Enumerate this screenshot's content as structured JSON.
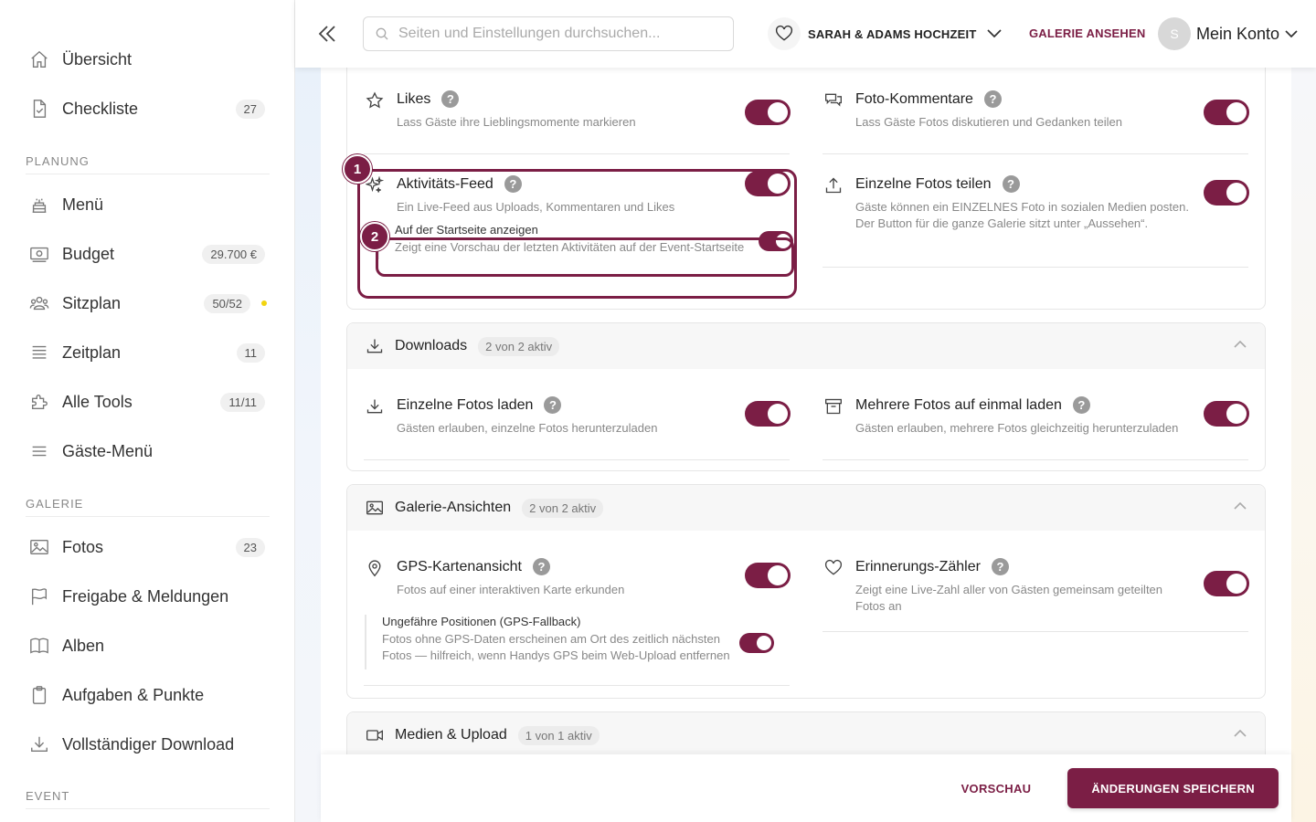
{
  "sidebar": {
    "items": [
      {
        "label": "Übersicht",
        "icon": "home-icon"
      },
      {
        "label": "Checkliste",
        "badge": "27",
        "icon": "checklist-icon"
      },
      {
        "label": "Menü",
        "icon": "cake-icon"
      },
      {
        "label": "Budget",
        "badge": "29.700 €",
        "icon": "money-icon"
      },
      {
        "label": "Sitzplan",
        "badge": "50/52",
        "icon": "people-icon"
      },
      {
        "label": "Zeitplan",
        "badge": "11",
        "icon": "timeline-icon"
      },
      {
        "label": "Alle Tools",
        "badge": "11/11",
        "icon": "puzzle-icon"
      },
      {
        "label": "Gäste-Menü",
        "icon": "menu-icon"
      },
      {
        "label": "Fotos",
        "badge": "23",
        "icon": "image-icon"
      },
      {
        "label": "Freigabe & Meldungen",
        "icon": "flag-icon"
      },
      {
        "label": "Alben",
        "icon": "book-icon"
      },
      {
        "label": "Aufgaben & Punkte",
        "icon": "clipboard-icon"
      },
      {
        "label": "Vollständiger Download",
        "icon": "download-icon"
      }
    ],
    "sections": {
      "planung": "PLANUNG",
      "galerie": "GALERIE",
      "event": "EVENT"
    }
  },
  "header": {
    "search_placeholder": "Seiten und Einstellungen durchsuchen...",
    "event_name": "SARAH & ADAMS HOCHZEIT",
    "gallery_link": "GALERIE ANSEHEN",
    "avatar_initial": "S",
    "account_label": "Mein Konto"
  },
  "interactions": {
    "likes": {
      "title": "Likes",
      "desc": "Lass Gäste ihre Lieblingsmomente markieren"
    },
    "comments": {
      "title": "Foto-Kommentare",
      "desc": "Lass Gäste Fotos diskutieren und Gedanken teilen"
    },
    "activity": {
      "title": "Aktivitäts-Feed",
      "desc": "Ein Live-Feed aus Uploads, Kommentaren und Likes"
    },
    "activity_sub": {
      "title": "Auf der Startseite anzeigen",
      "desc": "Zeigt eine Vorschau der letzten Aktivitäten auf der Event-Startseite"
    },
    "share": {
      "title": "Einzelne Fotos teilen",
      "desc": "Gäste können ein EINZELNES Foto in sozialen Medien posten. Der Button für die ganze Galerie sitzt unter „Aussehen“."
    }
  },
  "downloads": {
    "title": "Downloads",
    "count": "2 von 2 aktiv",
    "single": {
      "title": "Einzelne Fotos laden",
      "desc": "Gästen erlauben, einzelne Fotos herunterzuladen"
    },
    "multi": {
      "title": "Mehrere Fotos auf einmal laden",
      "desc": "Gästen erlauben, mehrere Fotos gleichzeitig herunterzuladen"
    }
  },
  "views": {
    "title": "Galerie-Ansichten",
    "count": "2 von 2 aktiv",
    "gps": {
      "title": "GPS-Kartenansicht",
      "desc": "Fotos auf einer interaktiven Karte erkunden"
    },
    "gps_sub": {
      "title": "Ungefähre Positionen (GPS-Fallback)",
      "desc": "Fotos ohne GPS-Daten erscheinen am Ort des zeitlich nächsten Fotos — hilfreich, wenn Handys GPS beim Web-Upload entfernen"
    },
    "memory": {
      "title": "Erinnerungs-Zähler",
      "desc": "Zeigt eine Live-Zahl aller von Gästen gemeinsam geteilten Fotos an"
    }
  },
  "media": {
    "title": "Medien & Upload",
    "count": "1 von 1 aktiv"
  },
  "highlights": {
    "one": "1",
    "two": "2"
  },
  "help_glyph": "?",
  "footer": {
    "preview": "VORSCHAU",
    "save": "ÄNDERUNGEN SPEICHERN"
  },
  "colors": {
    "accent": "#7b1e45"
  }
}
